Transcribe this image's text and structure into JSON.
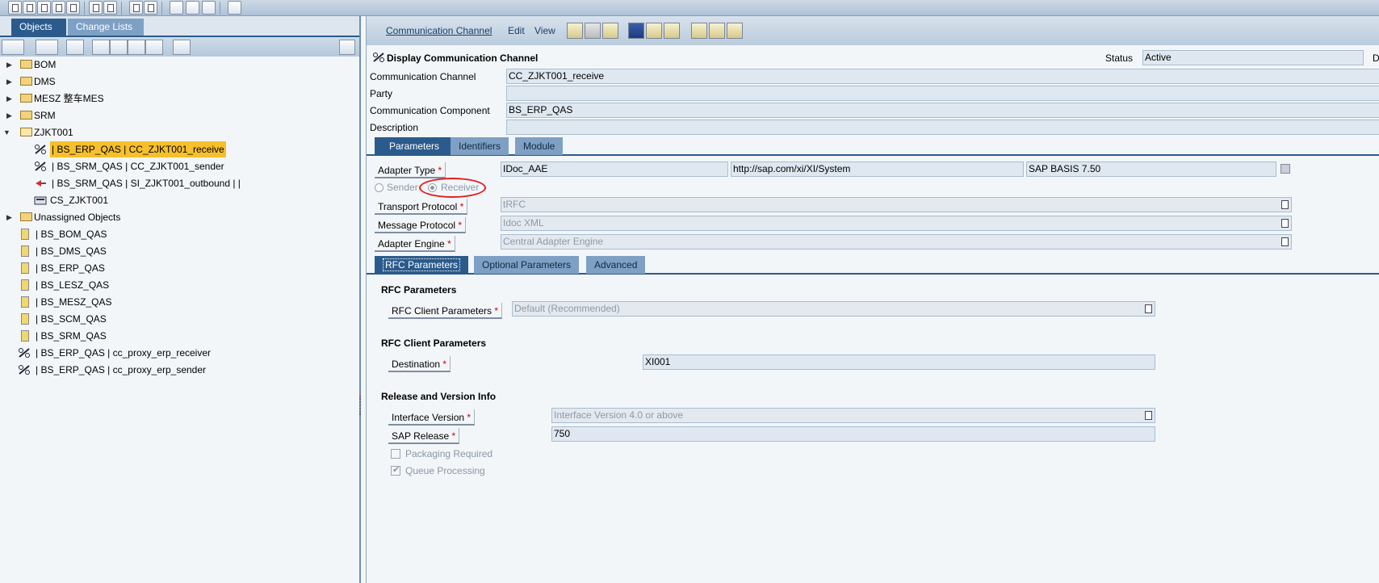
{
  "left_tabs": {
    "objects": "Objects",
    "change_lists": "Change Lists"
  },
  "tree": {
    "folders_top": [
      "BOM",
      "DMS",
      "MESZ  整车MES",
      "SRM",
      "ZJKT001"
    ],
    "zjkt_children": [
      "| BS_ERP_QAS | CC_ZJKT001_receive",
      "| BS_SRM_QAS | CC_ZJKT001_sender",
      "| BS_SRM_QAS | SI_ZJKT001_outbound |  |",
      "CS_ZJKT001"
    ],
    "unassigned": "Unassigned Objects",
    "unassigned_children": [
      "| BS_BOM_QAS",
      "| BS_DMS_QAS",
      "| BS_ERP_QAS",
      "| BS_LESZ_QAS",
      "| BS_MESZ_QAS",
      "| BS_SCM_QAS",
      "| BS_SRM_QAS",
      "| BS_ERP_QAS | cc_proxy_erp_receiver",
      "| BS_ERP_QAS | cc_proxy_erp_sender"
    ]
  },
  "menu": {
    "communication_channel": "Communication Channel",
    "edit": "Edit",
    "view": "View"
  },
  "header": {
    "title": "Display Communication Channel",
    "status_label": "Status",
    "status_value": "Active",
    "trailing": "D"
  },
  "fields": {
    "channel_label": "Communication Channel",
    "channel_value": "CC_ZJKT001_receive",
    "party_label": "Party",
    "party_value": "",
    "component_label": "Communication Component",
    "component_value": "BS_ERP_QAS",
    "description_label": "Description",
    "description_value": ""
  },
  "tabs": {
    "parameters": "Parameters",
    "identifiers": "Identifiers",
    "module": "Module"
  },
  "adapter": {
    "type_label": "Adapter Type",
    "type_value": "IDoc_AAE",
    "namespace": "http://sap.com/xi/XI/System",
    "swcv": "SAP BASIS 7.50",
    "sender": "Sender",
    "receiver": "Receiver",
    "transport_label": "Transport Protocol",
    "transport_value": "tRFC",
    "message_label": "Message Protocol",
    "message_value": "Idoc XML",
    "engine_label": "Adapter Engine",
    "engine_value": "Central Adapter Engine"
  },
  "subtabs": {
    "rfc": "RFC Parameters",
    "optional": "Optional Parameters",
    "advanced": "Advanced"
  },
  "rfc": {
    "section1": "RFC Parameters",
    "client_params_label": "RFC Client Parameters",
    "client_params_value": "Default (Recommended)",
    "section2": "RFC Client Parameters",
    "destination_label": "Destination",
    "destination_value": "XI001",
    "section3": "Release and Version Info",
    "iface_label": "Interface Version",
    "iface_value": "Interface Version 4.0 or above",
    "release_label": "SAP Release",
    "release_value": "750",
    "packaging": "Packaging Required",
    "queue": "Queue Processing"
  },
  "required_mark": "*"
}
